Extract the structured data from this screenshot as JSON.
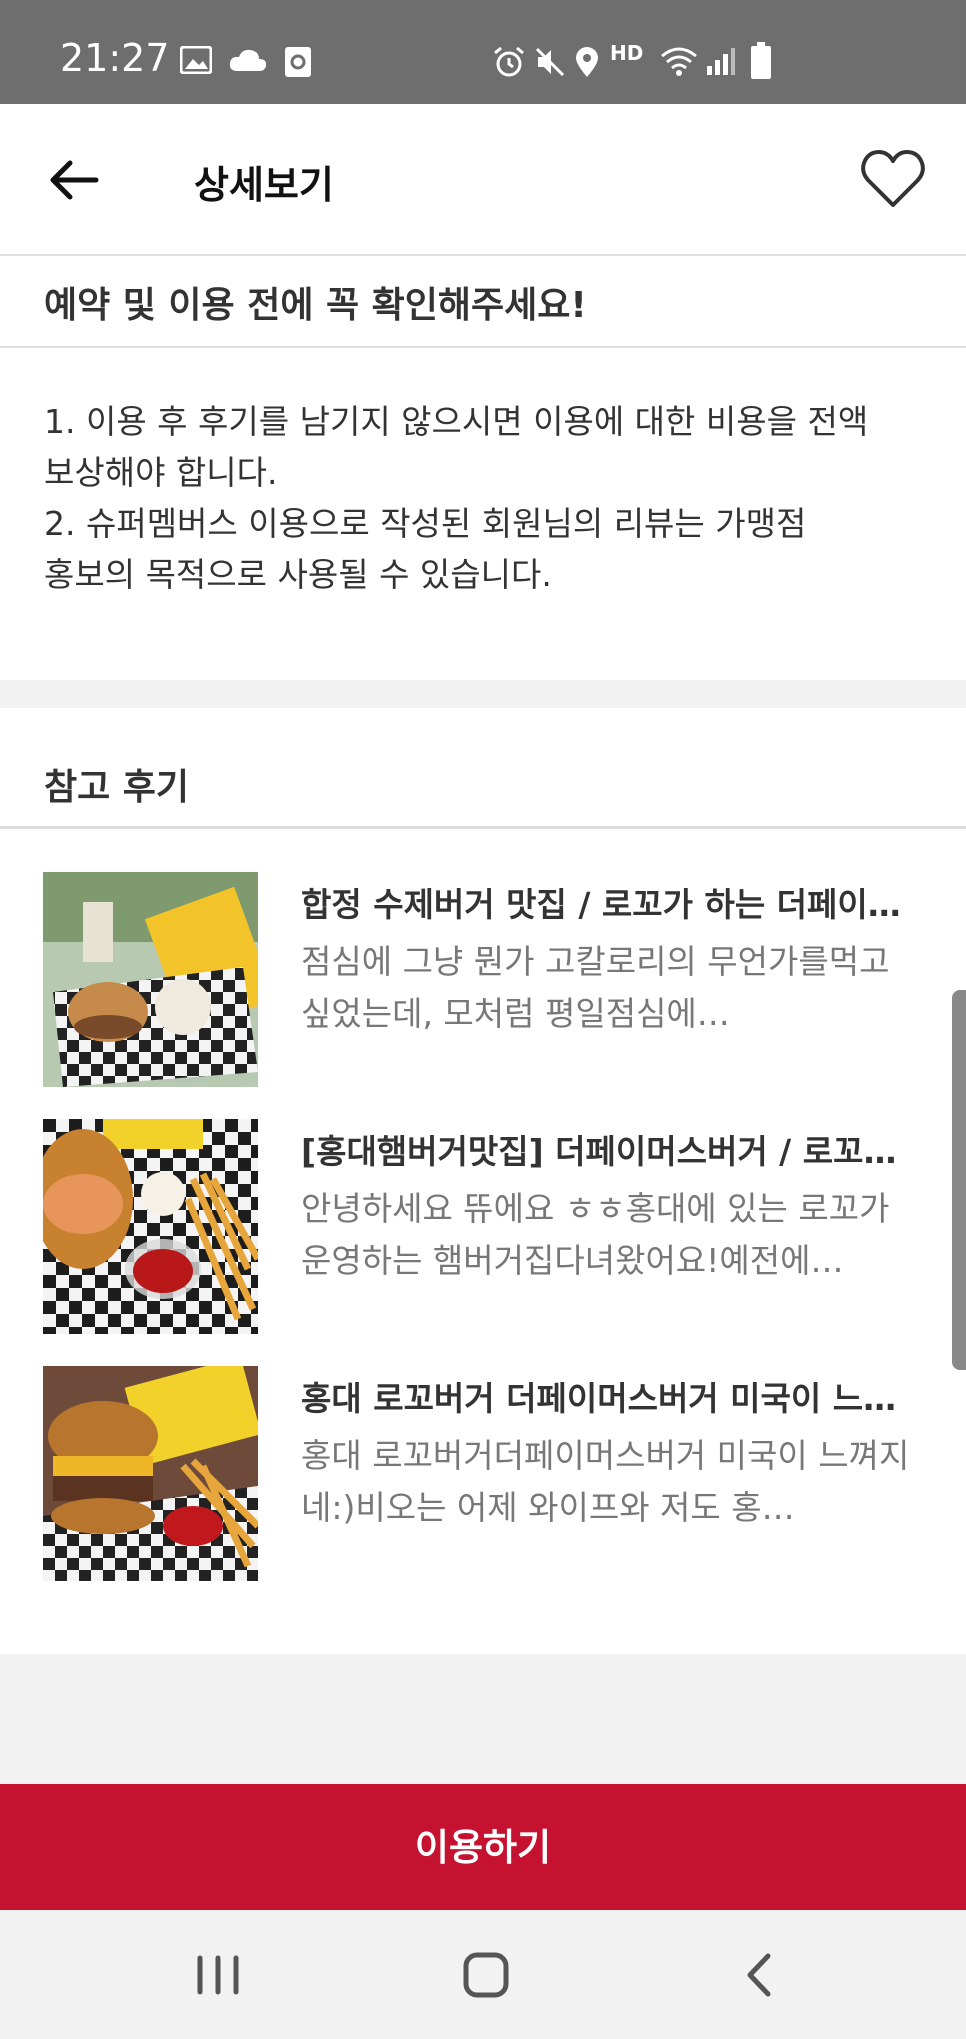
{
  "status_bar": {
    "time": "21:27",
    "icons": [
      "image-icon",
      "cloud-icon",
      "screen-record-icon",
      "alarm-icon",
      "mute-icon",
      "location-icon",
      "hd-voice-icon",
      "wifi-icon",
      "signal-icon",
      "battery-icon"
    ],
    "hd_label": "HD"
  },
  "header": {
    "title": "상세보기",
    "back_icon": "arrow-left-icon",
    "favorite_icon": "heart-outline-icon"
  },
  "notice": {
    "title": "예약 및 이용 전에 꼭 확인해주세요!",
    "lines": [
      "1. 이용 후 후기를 남기지 않으시면 이용에 대한 비용을 전액",
      "보상해야 합니다.",
      "2. 슈퍼멤버스 이용으로 작성된 회원님의 리뷰는 가맹점",
      "홍보의 목적으로 사용될 수 있습니다."
    ]
  },
  "reviews": {
    "title": "참고 후기",
    "items": [
      {
        "title": "합정 수제버거 맛집 / 로꼬가 하는 더페이머스버거",
        "snippet": "점심에 그냥 뭔가 고칼로리의 무언가를먹고 싶었는데, 모처럼 평일점심에…"
      },
      {
        "title": "[홍대햄버거맛집] 더페이머스버거 / 로꼬가 운영하는",
        "snippet": "안녕하세요 뜌에요 ㅎㅎ홍대에 있는 로꼬가 운영하는 햄버거집다녀왔어요!예전에…"
      },
      {
        "title": "홍대 로꼬버거 더페이머스버거 미국이 느껴지네",
        "snippet": "홍대 로꼬버거더페이머스버거 미국이 느껴지네:)비오는 어제 와이프와 저도 홍…"
      }
    ]
  },
  "cta": {
    "label": "이용하기"
  },
  "nav_bar": {
    "icons": [
      "recent-apps-icon",
      "home-icon",
      "back-icon"
    ]
  },
  "colors": {
    "accent": "#c41230",
    "status_bar": "#6e6e6e",
    "background": "#f2f2f2"
  }
}
